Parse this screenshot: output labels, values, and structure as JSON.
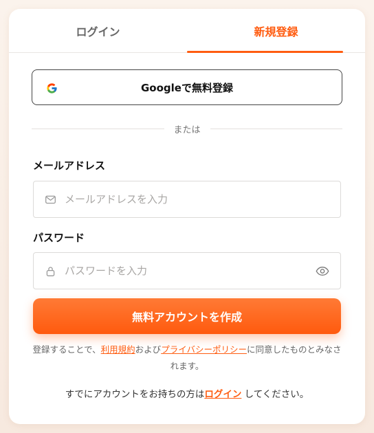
{
  "tabs": {
    "login": "ログイン",
    "signup": "新規登録"
  },
  "google_button": {
    "label": "Googleで無料登録",
    "icon": "google-logo-icon"
  },
  "divider_text": "または",
  "email": {
    "label": "メールアドレス",
    "placeholder": "メールアドレスを入力",
    "value": "",
    "icon": "mail-icon"
  },
  "password": {
    "label": "パスワード",
    "placeholder": "パスワードを入力",
    "value": "",
    "icon": "lock-icon",
    "toggle_icon": "eye-icon"
  },
  "submit_label": "無料アカウントを作成",
  "terms": {
    "prefix": "登録することで、",
    "terms_link": "利用規約",
    "middle": "および",
    "privacy_link": "プライバシーポリシー",
    "suffix": "に同意したものとみなされます。"
  },
  "already": {
    "prefix": "すでにアカウントをお持ちの方は",
    "login_link": "ログイン",
    "suffix": " してください。"
  },
  "colors": {
    "accent": "#ff5c10",
    "button_top": "#ff7a35",
    "button_bottom": "#ff5a0e"
  }
}
